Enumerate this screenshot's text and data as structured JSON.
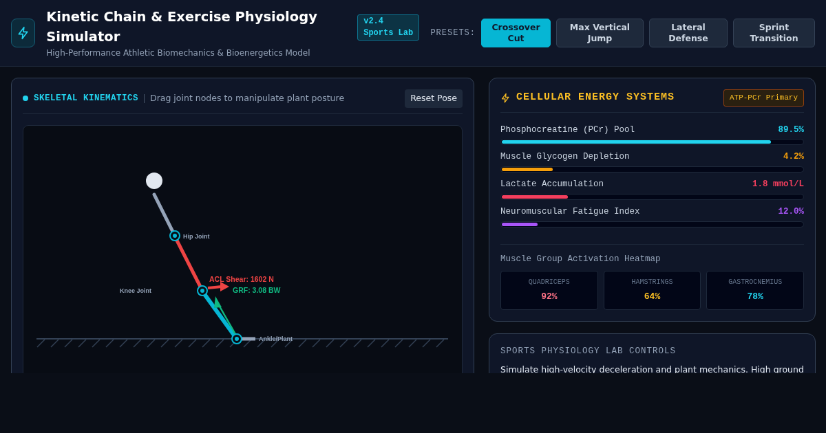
{
  "header": {
    "title": "Kinetic Chain & Exercise Physiology Simulator",
    "subtitle": "High-Performance Athletic Biomechanics & Bioenergetics Model",
    "version_badge": "v2.4 Sports Lab",
    "presets_label": "PRESETS:",
    "presets": [
      {
        "label": "Crossover Cut",
        "selected": true
      },
      {
        "label": "Max Vertical Jump",
        "selected": false
      },
      {
        "label": "Lateral Defense",
        "selected": false
      },
      {
        "label": "Sprint Transition",
        "selected": false
      }
    ]
  },
  "kinematics": {
    "title": "SKELETAL KINEMATICS",
    "hint": "Drag joint nodes to manipulate plant posture",
    "reset_button": "Reset Pose",
    "joints": [
      {
        "label": "Hip Joint"
      },
      {
        "label": "Knee Joint"
      },
      {
        "label": "Ankle/Plant"
      }
    ],
    "acl_label": "ACL Shear: 1602 N",
    "grf_label": "GRF: 3.08 BW"
  },
  "energy": {
    "title": "CELLULAR ENERGY SYSTEMS",
    "badge": "ATP-PCr Primary",
    "meters": [
      {
        "name": "Phosphocreatine (PCr) Pool",
        "reading": "89.5%",
        "level": 0.895,
        "color": "#22d3ee"
      },
      {
        "name": "Muscle Glycogen Depletion",
        "reading": "4.2%",
        "level": 0.17,
        "color": "#f59e0b"
      },
      {
        "name": "Lactate Accumulation",
        "reading": "1.8 mmol/L",
        "level": 0.22,
        "color": "#f43f5e"
      },
      {
        "name": "Neuromuscular Fatigue Index",
        "reading": "12.0%",
        "level": 0.12,
        "color": "#a855f7"
      }
    ],
    "heatmap_title": "Muscle Group Activation Heatmap",
    "muscles": [
      {
        "name": "QUADRICEPS",
        "value": "92%",
        "color": "#fb7185"
      },
      {
        "name": "HAMSTRINGS",
        "value": "64%",
        "color": "#fbbf24"
      },
      {
        "name": "GASTROCNEMIUS",
        "value": "78%",
        "color": "#22d3ee"
      }
    ]
  },
  "controls": {
    "title": "SPORTS PHYSIOLOGY LAB CONTROLS",
    "text": "Simulate high-velocity deceleration and plant mechanics. High ground"
  }
}
